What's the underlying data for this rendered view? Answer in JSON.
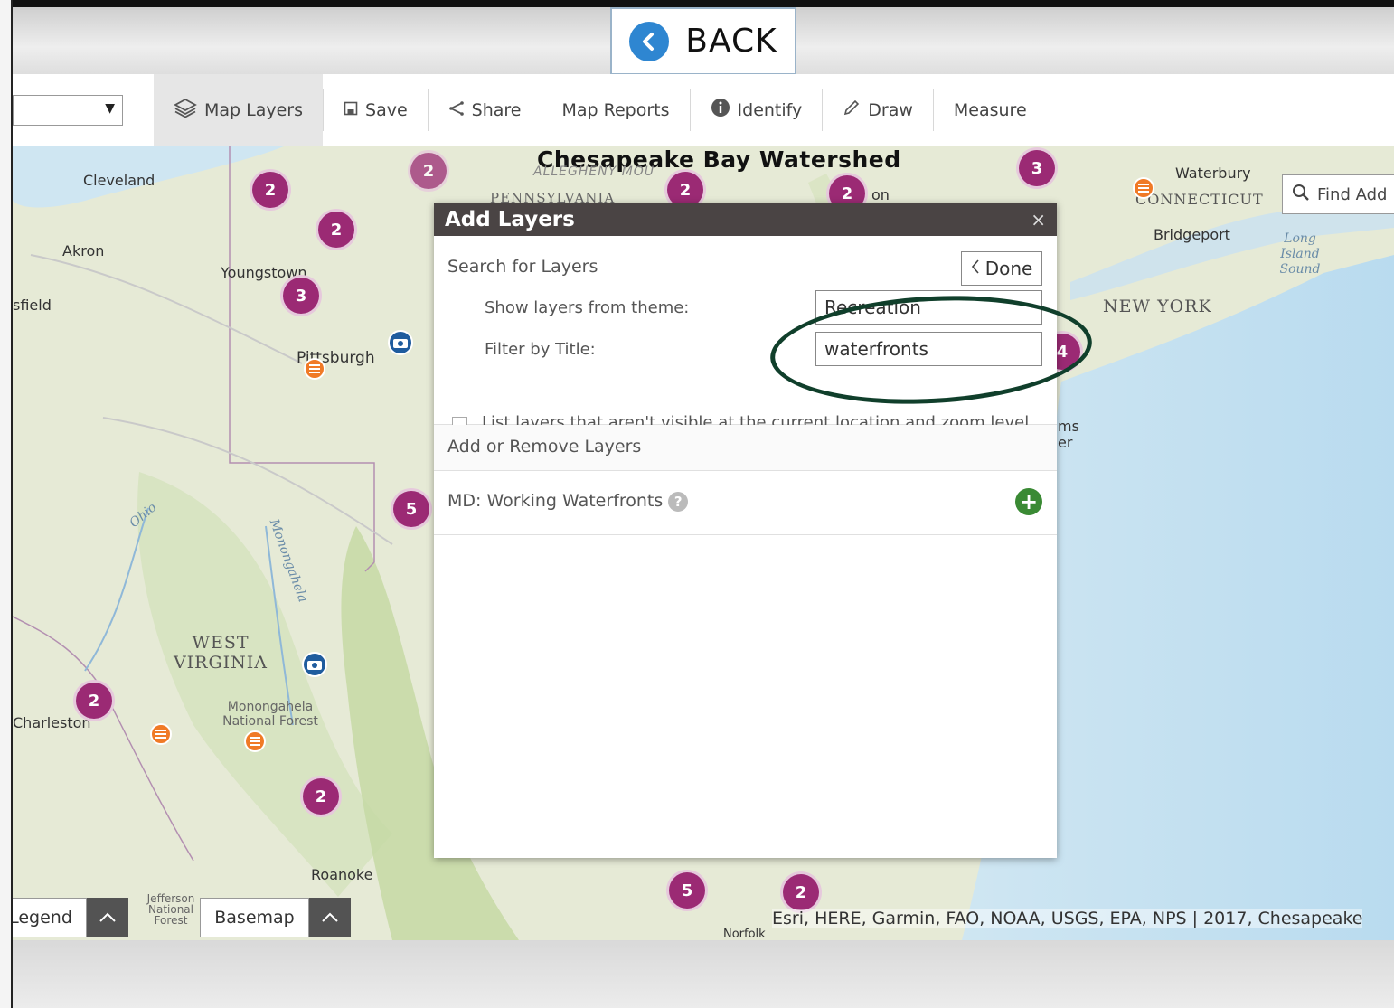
{
  "back": {
    "label": "BACK"
  },
  "toolbar": {
    "map_layers": "Map Layers",
    "save": "Save",
    "share": "Share",
    "map_reports": "Map Reports",
    "identify": "Identify",
    "draw": "Draw",
    "measure": "Measure"
  },
  "map": {
    "title": "Chesapeake Bay Watershed",
    "find_address": "Find Add",
    "labels": {
      "cleveland": "Cleveland",
      "akron": "Akron",
      "mansfield": "sfield",
      "youngstown": "Youngstown",
      "pittsburgh": "Pittsburgh",
      "charleston": "Charleston",
      "monongahela": "Monongahela National Forest",
      "roanoke": "Roanoke",
      "jefferson": "Jefferson National Forest",
      "waterbury": "Waterbury",
      "bridgeport": "Bridgeport",
      "norfolk": "Norfolk",
      "allegheny": "ALLEGHENY MOU",
      "pennsylvania": "PENNSYLVANIA",
      "ton": "on",
      "ms": "ms",
      "er": "er"
    },
    "states": {
      "west_virginia": "WEST VIRGINIA",
      "new_york": "NEW YORK",
      "connecticut": "CONNECTICUT"
    },
    "water": {
      "ohio": "Ohio",
      "monongahela_river": "Monongahela",
      "long_island_sound": "Long Island Sound"
    },
    "clusters": [
      "2",
      "2",
      "2",
      "3",
      "2",
      "2",
      "3",
      "4",
      "5",
      "2",
      "2",
      "5",
      "2"
    ],
    "attribution": "Esri, HERE, Garmin, FAO, NOAA, USGS, EPA, NPS | 2017, Chesapeake",
    "legend_button": "Legend",
    "basemap_button": "Basemap"
  },
  "dialog": {
    "title": "Add Layers",
    "close": "×",
    "search_heading": "Search for Layers",
    "done": "Done",
    "theme_label": "Show layers from theme:",
    "theme_value": "Recreation",
    "filter_label": "Filter by Title:",
    "filter_value": "waterfronts",
    "list_invisible_label": "List layers that aren't visible at the current location and zoom level",
    "add_remove_heading": "Add or Remove Layers",
    "layers": [
      {
        "name": "MD: Working Waterfronts",
        "help": "?",
        "add": "+"
      }
    ]
  },
  "colors": {
    "cluster": "#9b2a74",
    "orange_pin": "#f07a26",
    "blue_pin": "#1f5c9e",
    "dialog_header": "#4a4444",
    "add_green": "#3a8a34",
    "annotation": "#103f2b",
    "back_blue": "#2e86d1"
  },
  "icons": [
    "back-chevron-icon",
    "layers-icon",
    "save-icon",
    "share-icon",
    "info-icon",
    "pencil-icon",
    "search-icon",
    "chevron-up-icon",
    "close-icon",
    "chevron-left-icon",
    "help-icon",
    "plus-icon",
    "camera-icon",
    "list-icon"
  ]
}
